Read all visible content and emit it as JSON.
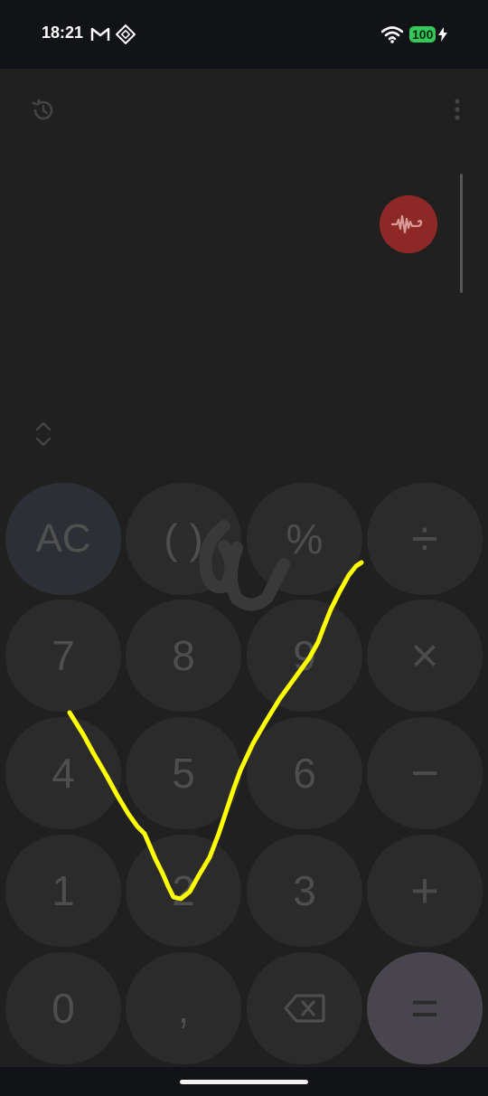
{
  "status_bar": {
    "time": "18:21",
    "battery": "100",
    "icons": [
      "gmail-icon",
      "sync-icon",
      "wifi-icon",
      "battery-icon",
      "charging-bolt-icon"
    ],
    "battery_color": "#34c759"
  },
  "toolbar": {
    "icons": [
      "history-icon",
      "more-vert-icon"
    ]
  },
  "voice": {
    "icon": "voice-wave-icon",
    "color": "#8e2826"
  },
  "keypad": {
    "rows": [
      [
        "AC",
        "( )",
        "%",
        "÷"
      ],
      [
        "7",
        "8",
        "9",
        "×"
      ],
      [
        "4",
        "5",
        "6",
        "−"
      ],
      [
        "1",
        "2",
        "3",
        "+"
      ],
      [
        "0",
        ",",
        "backspace",
        "="
      ]
    ]
  },
  "overlay": {
    "stroke_color": "#ffff00",
    "watermark_color": "#3a3a3a"
  }
}
